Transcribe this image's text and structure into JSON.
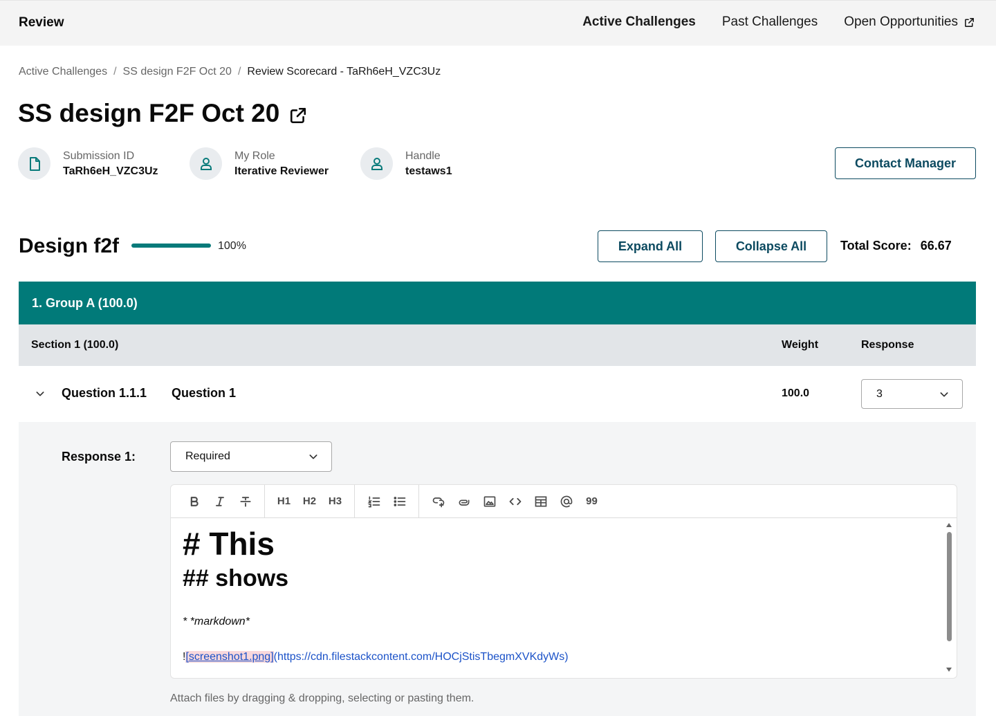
{
  "header": {
    "brand": "Review",
    "nav": [
      {
        "label": "Active Challenges"
      },
      {
        "label": "Past Challenges"
      },
      {
        "label": "Open Opportunities"
      }
    ]
  },
  "breadcrumb": {
    "items": [
      "Active Challenges",
      "SS design F2F Oct 20",
      "Review Scorecard - TaRh6eH_VZC3Uz"
    ],
    "separator": "/"
  },
  "page_title": "SS design F2F Oct 20",
  "info": {
    "submission": {
      "label": "Submission ID",
      "value": "TaRh6eH_VZC3Uz"
    },
    "role": {
      "label": "My Role",
      "value": "Iterative Reviewer"
    },
    "handle": {
      "label": "Handle",
      "value": "testaws1"
    },
    "contact_button": "Contact Manager"
  },
  "scorecard": {
    "title": "Design f2f",
    "progress_percent": 100,
    "progress_label": "100%",
    "expand_all": "Expand All",
    "collapse_all": "Collapse All",
    "total_score_label": "Total Score:",
    "total_score_value": "66.67"
  },
  "group": {
    "label": "1. Group A (100.0)"
  },
  "section": {
    "label": "Section 1 (100.0)",
    "weight_header": "Weight",
    "response_header": "Response"
  },
  "question": {
    "id": "Question 1.1.1",
    "name": "Question 1",
    "weight": "100.0",
    "response_value": "3"
  },
  "response": {
    "label": "Response 1:",
    "type_value": "Required",
    "toolbar": {
      "h1": "H1",
      "h2": "H2",
      "h3": "H3",
      "quote": "99"
    },
    "content": {
      "h1": "# This",
      "h2": "## shows",
      "list_item": "* *markdown*",
      "image_prefix": "!",
      "image_alt": "[screenshot1.png]",
      "image_url": "(https://cdn.filestackcontent.com/HOCjStisTbegmXVKdyWs)"
    },
    "attach_hint": "Attach files by dragging & dropping, selecting or pasting them."
  },
  "colors": {
    "teal": "#017a79",
    "navy_outline": "#0c4a60",
    "section_gray": "#e2e5e8",
    "panel_gray": "#f4f5f6"
  }
}
